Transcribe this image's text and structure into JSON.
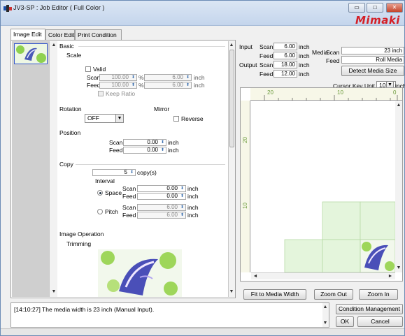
{
  "window": {
    "title": "JV3-SP : Job Editor ( Full Color )",
    "logo": "Mimaki",
    "buttons": {
      "minimize": "▭",
      "maximize": "□",
      "close": "✕"
    }
  },
  "tabs": [
    {
      "label": "Image Edit",
      "active": true
    },
    {
      "label": "Color Edit",
      "active": false
    },
    {
      "label": "Print Condition",
      "active": false
    }
  ],
  "props": {
    "basic": "Basic",
    "scale": {
      "heading": "Scale",
      "valid_label": "Valid",
      "scan_label": "Scan",
      "feed_label": "Feed",
      "scan_pct": "100.00",
      "feed_pct": "100.00",
      "pct_unit": "%",
      "scan_inch": "6.00",
      "feed_inch": "6.00",
      "inch_unit": "inch",
      "keep_ratio": "Keep Ratio"
    },
    "rotation": {
      "label": "Rotation",
      "value": "OFF"
    },
    "mirror": {
      "label": "Mirror",
      "reverse_label": "Reverse"
    },
    "position": {
      "heading": "Position",
      "scan_label": "Scan",
      "feed_label": "Feed",
      "scan": "0.00",
      "feed": "0.00",
      "unit": "inch"
    },
    "copy": {
      "heading": "Copy",
      "count": "5",
      "count_unit": "copy(s)",
      "interval": "Interval",
      "space_label": "Space",
      "pitch_label": "Pitch",
      "space_scan": "0.00",
      "space_feed": "0.00",
      "pitch_scan": "6.00",
      "pitch_feed": "6.00",
      "scan_label": "Scan",
      "feed_label": "Feed",
      "unit": "inch"
    },
    "image_operation": "Image Operation",
    "trimming": "Trimming"
  },
  "info": {
    "input_label": "Input",
    "output_label": "Output",
    "scan_label": "Scan",
    "feed_label": "Feed",
    "input_scan": "6.00",
    "input_feed": "6.00",
    "output_scan": "18.00",
    "output_feed": "12.00",
    "unit": "inch",
    "media_label": "Media",
    "media_scan_label": "Scan",
    "media_feed_label": "Feed",
    "media_scan": "23 inch",
    "media_feed": "Roll Media",
    "detect_button": "Detect Media Size",
    "cursor_key_label": "Cursor Key Unit",
    "cursor_key_value": "10",
    "cursor_key_unit": "inch"
  },
  "ruler": {
    "top_labels": [
      "20",
      "10",
      "0"
    ],
    "left_labels": [
      "20",
      "10"
    ]
  },
  "preview_buttons": {
    "fit": "Fit to Media Width",
    "zoom_out": "Zoom Out",
    "zoom_in": "Zoom In"
  },
  "status_message": "[14:10:27] The media width is 23 inch (Manual Input).",
  "bottom_buttons": {
    "condition": "Condition Management",
    "ok": "OK",
    "cancel": "Cancel"
  },
  "colors": {
    "accent": "#d41f26",
    "selection": "#3355cc",
    "layout_fill": "#e4f5dc",
    "layout_line": "#b7d9a6"
  },
  "icons": [
    "app-icon",
    "scroll-up-icon",
    "scroll-down-icon",
    "dropdown-arrow-icon",
    "spin-icon"
  ]
}
